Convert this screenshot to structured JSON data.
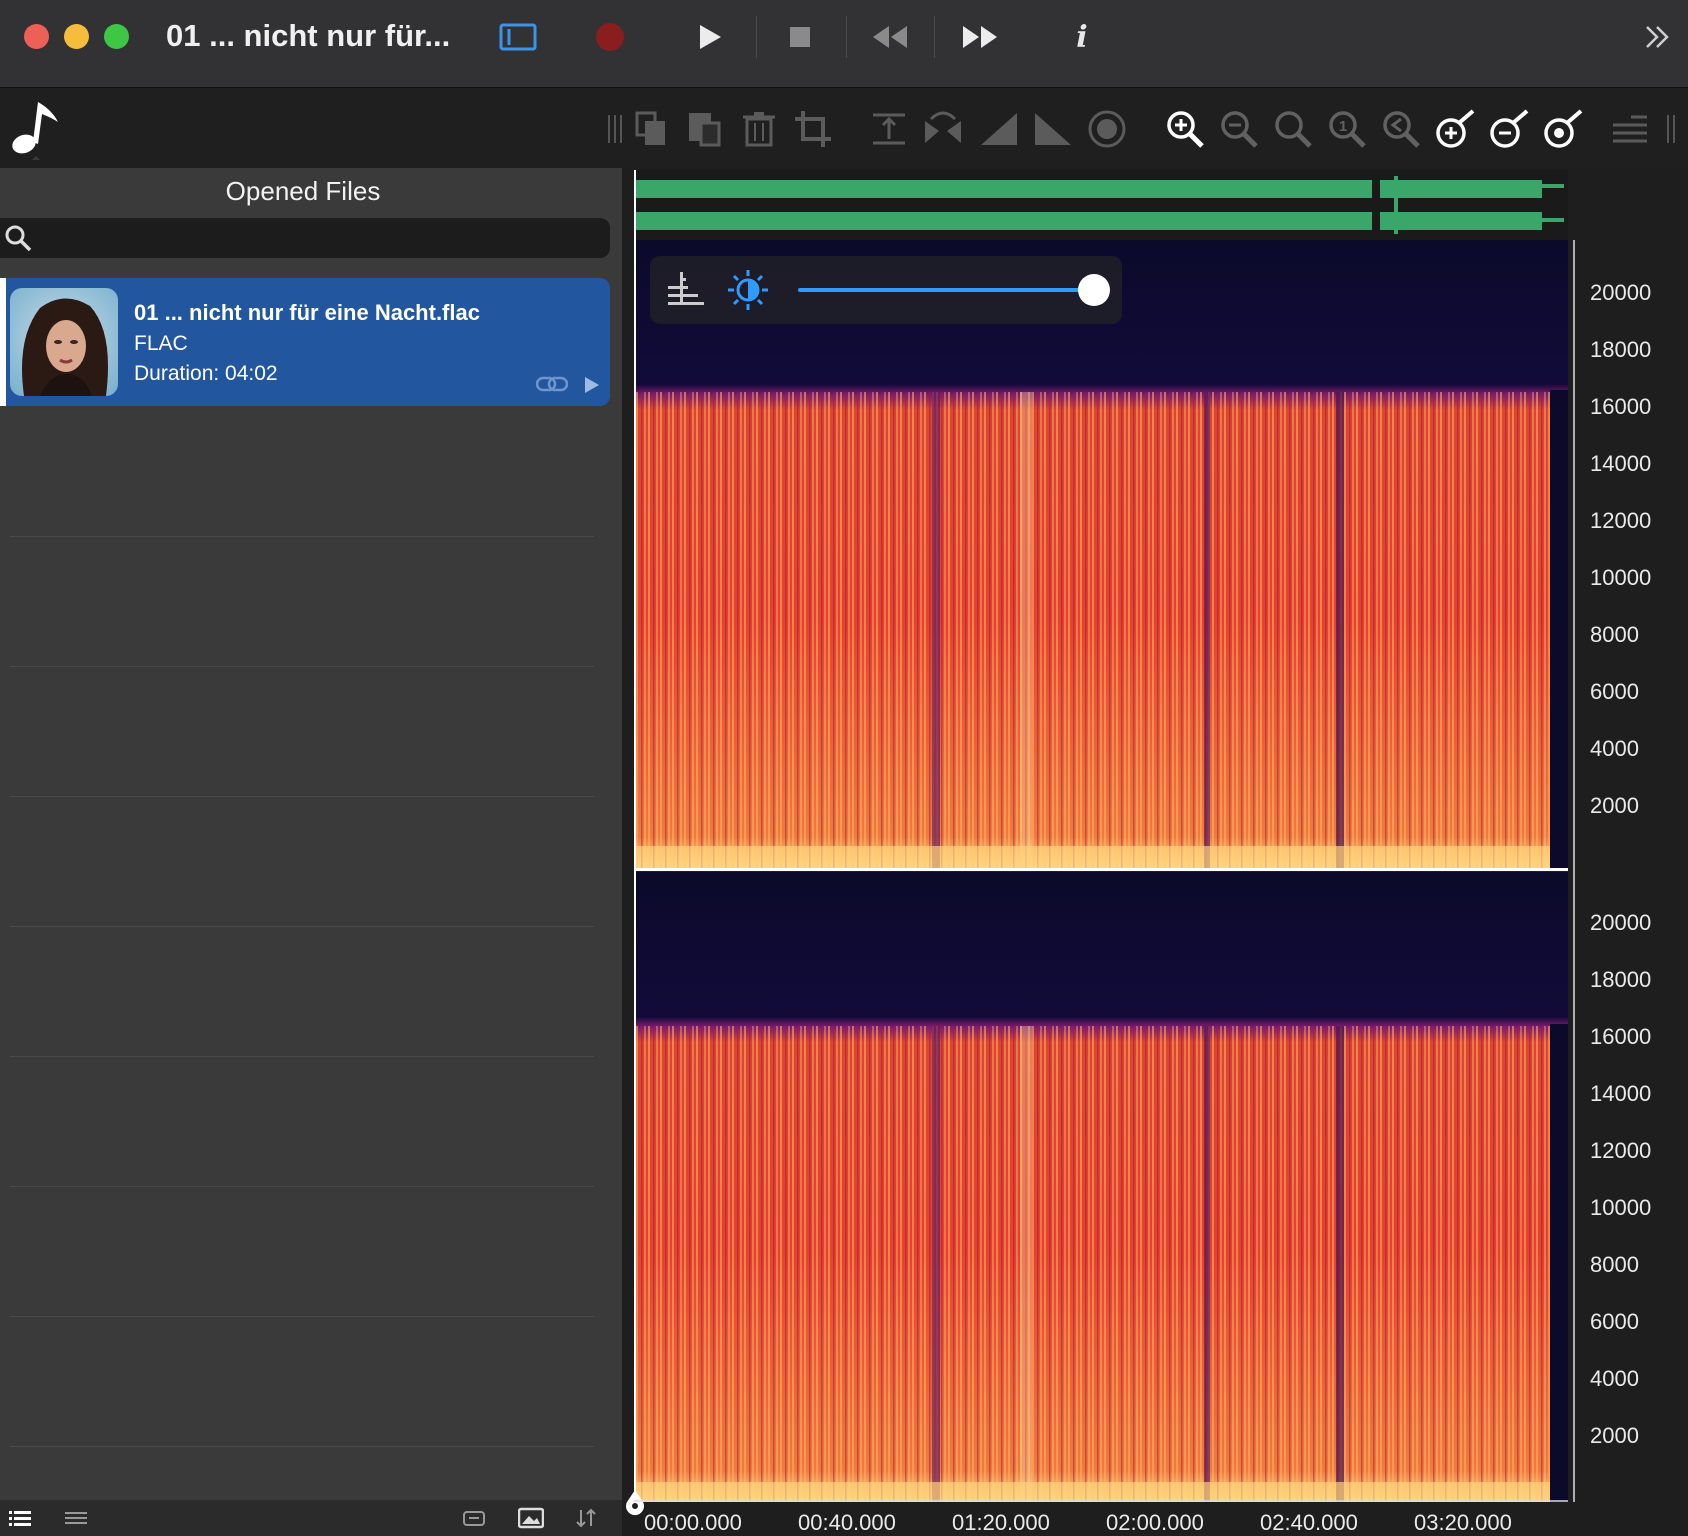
{
  "window": {
    "title": "01 ... nicht nur für...",
    "traffic_lights": [
      "close",
      "minimize",
      "maximize"
    ],
    "colors": {
      "close": "#ee5f56",
      "minimize": "#f5bd3b",
      "maximize": "#3ec645"
    }
  },
  "titlebar_buttons": [
    "sidebar-toggle-icon",
    "record-icon",
    "play-icon",
    "stop-icon",
    "rewind-icon",
    "fast-forward-icon",
    "info-icon",
    "overflow-chevron-icon"
  ],
  "toolbar": {
    "tools": [
      "grip-icon",
      "copy-icon",
      "paste-icon",
      "trash-icon",
      "crop-icon",
      "normalize-icon",
      "reverse-icon",
      "fade-in-icon",
      "fade-out-icon",
      "silence-icon",
      "zoom-in-icon",
      "zoom-out-icon",
      "zoom-fit-icon",
      "zoom-selection-icon",
      "zoom-reset-icon",
      "gain-up-icon",
      "gain-down-icon",
      "gain-settings-icon",
      "list-icon",
      "grip-right-icon"
    ]
  },
  "sidebar": {
    "title": "Opened Files",
    "search": {
      "placeholder": ""
    },
    "files": [
      {
        "name": "01 ... nicht nur für eine Nacht.flac",
        "format": "FLAC",
        "duration": "Duration: 04:02",
        "selected": true
      }
    ],
    "accent_color": "#2257a0"
  },
  "spectrogram": {
    "channels": 2,
    "y_ticks": [
      "20000",
      "18000",
      "16000",
      "14000",
      "12000",
      "10000",
      "8000",
      "6000",
      "4000",
      "2000"
    ],
    "x_ticks": [
      "00:00.000",
      "00:40.000",
      "01:20.000",
      "02:00.000",
      "02:40.000",
      "03:20.000"
    ],
    "brightness_slider": 0.92,
    "waveform_color": "#3aa66a"
  }
}
